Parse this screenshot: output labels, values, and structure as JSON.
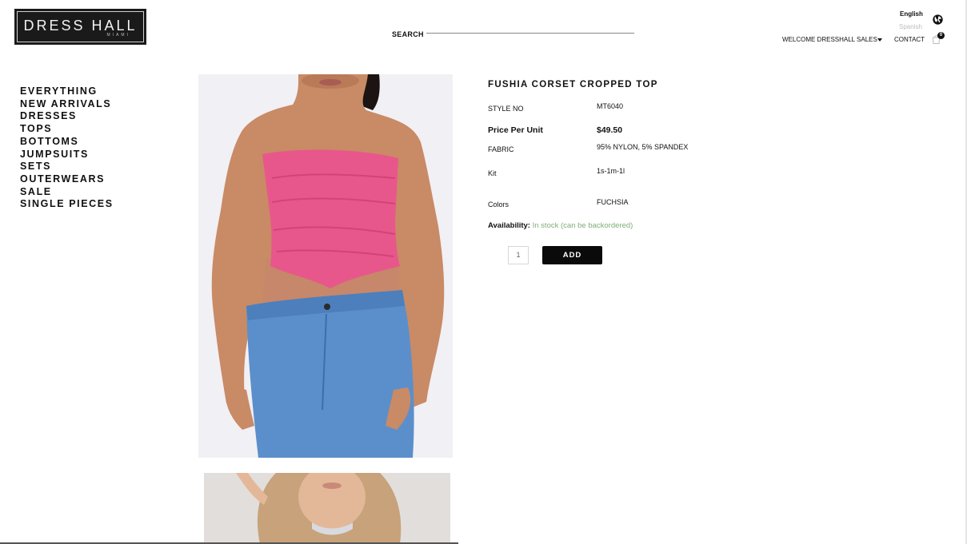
{
  "header": {
    "logo_title": "DRESS HALL",
    "logo_sub": "MIAMI",
    "search_label": "SEARCH",
    "lang_primary": "English",
    "lang_secondary": "Spanish",
    "welcome": "WELCOME DRESSHALL SALES",
    "contact": "CONTACT",
    "cart_count": "0",
    "icons": [
      "globe-icon",
      "caret-down-icon",
      "cart-icon"
    ]
  },
  "nav": {
    "items": [
      "EVERYTHING",
      "NEW ARRIVALS",
      "DRESSES",
      "TOPS",
      "BOTTOMS",
      "JUMPSUITS",
      "SETS",
      "OUTERWEARS",
      "SALE",
      "SINGLE PIECES"
    ]
  },
  "product": {
    "title": "FUSHIA CORSET CROPPED TOP",
    "style_label": "STYLE NO",
    "style_value": "MT6040",
    "price_label": "Price Per Unit",
    "price_value": "$49.50",
    "fabric_label": "FABRIC",
    "fabric_value": "95% NYLON, 5% SPANDEX",
    "kit_label": "Kit",
    "kit_value": "1s-1m-1l",
    "colors_label": "Colors",
    "colors_value": "FUCHSIA",
    "availability_label": "Availability:",
    "availability_value": "In stock (can be backordered)",
    "quantity": "1",
    "add_label": "ADD"
  },
  "colors": {
    "accent": "#0a0a0a",
    "stock_green": "#7fae76",
    "top_pink": "#e8578b",
    "denim": "#5b8fcb"
  }
}
